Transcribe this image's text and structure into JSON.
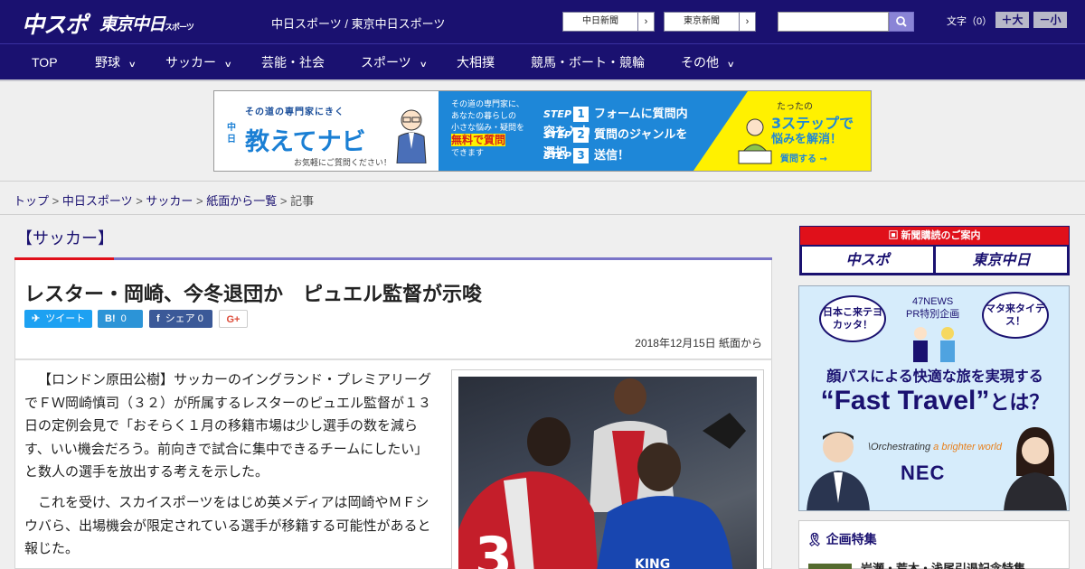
{
  "header": {
    "logo_main": "中スポ",
    "logo_sub": "東京中日",
    "logo_sub_small": "スポーツ",
    "site_name": "中日スポーツ / 東京中日スポーツ",
    "links": [
      {
        "label": "中日新聞"
      },
      {
        "label": "東京新聞"
      }
    ],
    "search_placeholder": "",
    "font_size_label": "文字（0）",
    "font_bigger": "＋大",
    "font_smaller": "－小",
    "colors": {
      "navy": "#1a1170",
      "accent": "#e0101a"
    }
  },
  "nav": {
    "items": [
      {
        "label": "TOP",
        "has_menu": false
      },
      {
        "label": "野球",
        "has_menu": true
      },
      {
        "label": "サッカー",
        "has_menu": true
      },
      {
        "label": "芸能・社会",
        "has_menu": false
      },
      {
        "label": "スポーツ",
        "has_menu": true
      },
      {
        "label": "大相撲",
        "has_menu": false
      },
      {
        "label": "競馬・ボート・競輪",
        "has_menu": false
      },
      {
        "label": "その他",
        "has_menu": true
      }
    ]
  },
  "banner": {
    "subtitle": "その道の専門家にきく",
    "small_prefix": "中日",
    "brand": "教えてナビ",
    "note": "お気軽にご質問ください！",
    "mid_text_1": "その道の専門家に、",
    "mid_text_2": "あなたの暮らしの",
    "mid_text_3": "小さな悩み・疑問を",
    "mid_highlight": "無料で質問",
    "mid_text_4": "できます",
    "steps": [
      {
        "label": "STEP",
        "num": "1",
        "text": "フォームに質問内容を入力"
      },
      {
        "label": "STEP",
        "num": "2",
        "text": "質問のジャンルを選択"
      },
      {
        "label": "STEP",
        "num": "3",
        "text": "送信！"
      }
    ],
    "right_small": "たったの",
    "right_big": "3ステップで",
    "right_mid": "悩みを解消！",
    "right_cta": "質問する →"
  },
  "breadcrumb": {
    "items": [
      "トップ",
      "中日スポーツ",
      "サッカー",
      "紙面から一覧"
    ],
    "current": "記事",
    "sep": " > "
  },
  "article": {
    "category": "【サッカー】",
    "title": "レスター・岡崎、今冬退団か　ピュエル監督が示唆",
    "share": {
      "tweet": "ツイート",
      "hatena_icon": "B!",
      "hatena_count": "0",
      "fb_label": "シェア",
      "fb_count": "0",
      "gplus": "G+"
    },
    "date": "2018年12月15日 紙面から",
    "paragraphs": [
      "【ロンドン原田公樹】サッカーのイングランド・プレミアリーグでＦＷ岡崎慎司（３２）が所属するレスターのピュエル監督が１３日の定例会見で「おそらく１月の移籍市場は少し選手の数を減らす、いい機会だろう。前向きで試合に集中できるチームにしたい」と数人の選手を放出する考えを示した。",
      "これを受け、スカイスポーツをはじめ英メディアは岡崎やＭＦシウバら、出場機会が限定されている選手が移籍する可能性があると報じた。"
    ]
  },
  "sidebar": {
    "subscribe_title": "新聞購読のご案内",
    "subscribe_a": "中スポ",
    "subscribe_b": "東京中日",
    "ad": {
      "tag1": "47NEWS",
      "tag2": "PR特別企画",
      "bubble_left": "日本こ来テヨカッタ！",
      "bubble_right": "マタ来タイデス！",
      "line1": "顔パスによる快適な旅を実現する",
      "line2_a": "“Fast Travel”",
      "line2_b": "とは？",
      "slogan_a": "\\Orchestrating",
      "slogan_b": "a brighter world",
      "nec": "NEC"
    },
    "kikaku_title": "企画特集",
    "kikaku_item": "岩瀬・荒木・浅尾引退記念特集"
  }
}
